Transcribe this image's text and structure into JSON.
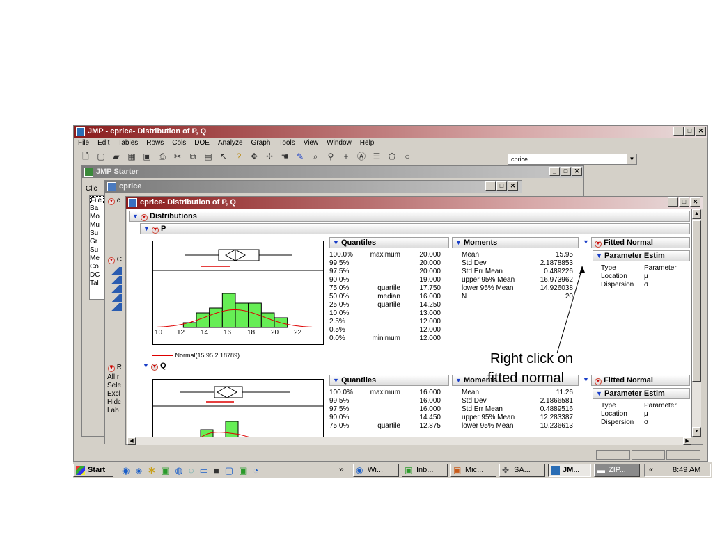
{
  "main_window": {
    "title": "JMP - cprice- Distribution of P, Q",
    "menu": [
      "File",
      "Edit",
      "Tables",
      "Rows",
      "Cols",
      "DOE",
      "Analyze",
      "Graph",
      "Tools",
      "View",
      "Window",
      "Help"
    ],
    "table_combo": "cprice"
  },
  "starter_window": {
    "title": "JMP Starter",
    "click_label": "Clic",
    "list": [
      "File",
      "Ba",
      "Mo",
      "Mu",
      "Su",
      "Gr",
      "Su",
      "Me",
      "Co",
      "DC",
      "Tal"
    ]
  },
  "cprice_window": {
    "title": "cprice",
    "col_label": "c"
  },
  "left_panel": {
    "rows_label": "R",
    "rows_items": [
      "All r",
      "Sele",
      "Excl",
      "Hidc",
      "Lab"
    ],
    "cols_label": "C"
  },
  "dist_window": {
    "title": "cprice- Distribution of P, Q",
    "distributions_label": "Distributions",
    "p_label": "P",
    "q_label": "Q",
    "normal_legend": "Normal(15.95,2.18789)"
  },
  "histogram_p": {
    "x_ticks": [
      "10",
      "12",
      "14",
      "16",
      "18",
      "20",
      "22"
    ],
    "bars": [
      1,
      3,
      4,
      7,
      5,
      5,
      3,
      2
    ],
    "bar_start": 12,
    "bar_width": 1
  },
  "quantiles_p": {
    "title": "Quantiles",
    "rows": [
      [
        "100.0%",
        "maximum",
        "20.000"
      ],
      [
        "99.5%",
        "",
        "20.000"
      ],
      [
        "97.5%",
        "",
        "20.000"
      ],
      [
        "90.0%",
        "",
        "19.000"
      ],
      [
        "75.0%",
        "quartile",
        "17.750"
      ],
      [
        "50.0%",
        "median",
        "16.000"
      ],
      [
        "25.0%",
        "quartile",
        "14.250"
      ],
      [
        "10.0%",
        "",
        "13.000"
      ],
      [
        "2.5%",
        "",
        "12.000"
      ],
      [
        "0.5%",
        "",
        "12.000"
      ],
      [
        "0.0%",
        "minimum",
        "12.000"
      ]
    ]
  },
  "moments_p": {
    "title": "Moments",
    "rows": [
      [
        "Mean",
        "15.95"
      ],
      [
        "Std Dev",
        "2.1878853"
      ],
      [
        "Std Err Mean",
        "0.489226"
      ],
      [
        "upper 95% Mean",
        "16.973962"
      ],
      [
        "lower 95% Mean",
        "14.926038"
      ],
      [
        "N",
        "20"
      ]
    ]
  },
  "fitted_p": {
    "title": "Fitted Normal",
    "param_title": "Parameter Estim",
    "rows": [
      [
        "Type",
        "Parameter"
      ],
      [
        "Location",
        "μ"
      ],
      [
        "Dispersion",
        "σ"
      ]
    ]
  },
  "quantiles_q": {
    "title": "Quantiles",
    "rows": [
      [
        "100.0%",
        "maximum",
        "16.000"
      ],
      [
        "99.5%",
        "",
        "16.000"
      ],
      [
        "97.5%",
        "",
        "16.000"
      ],
      [
        "90.0%",
        "",
        "14.450"
      ],
      [
        "75.0%",
        "quartile",
        "12.875"
      ]
    ]
  },
  "moments_q": {
    "title": "Moments",
    "rows": [
      [
        "Mean",
        "11.26"
      ],
      [
        "Std Dev",
        "2.1866581"
      ],
      [
        "Std Err Mean",
        "0.4889516"
      ],
      [
        "upper 95% Mean",
        "12.283387"
      ],
      [
        "lower 95% Mean",
        "10.236613"
      ]
    ]
  },
  "fitted_q": {
    "title": "Fitted Normal",
    "param_title": "Parameter Estim",
    "rows": [
      [
        "Type",
        "Parameter"
      ],
      [
        "Location",
        "μ"
      ],
      [
        "Dispersion",
        "σ"
      ]
    ]
  },
  "annotation": {
    "line1": "Right click on",
    "line2": "fitted normal"
  },
  "taskbar": {
    "start": "Start",
    "quicklaunch_more": "»",
    "tasks": [
      "Wi...",
      "Inb...",
      "Mic...",
      "SA...",
      "JM...",
      "ZIP..."
    ],
    "tray_arrow": "«",
    "clock": "8:49 AM"
  }
}
